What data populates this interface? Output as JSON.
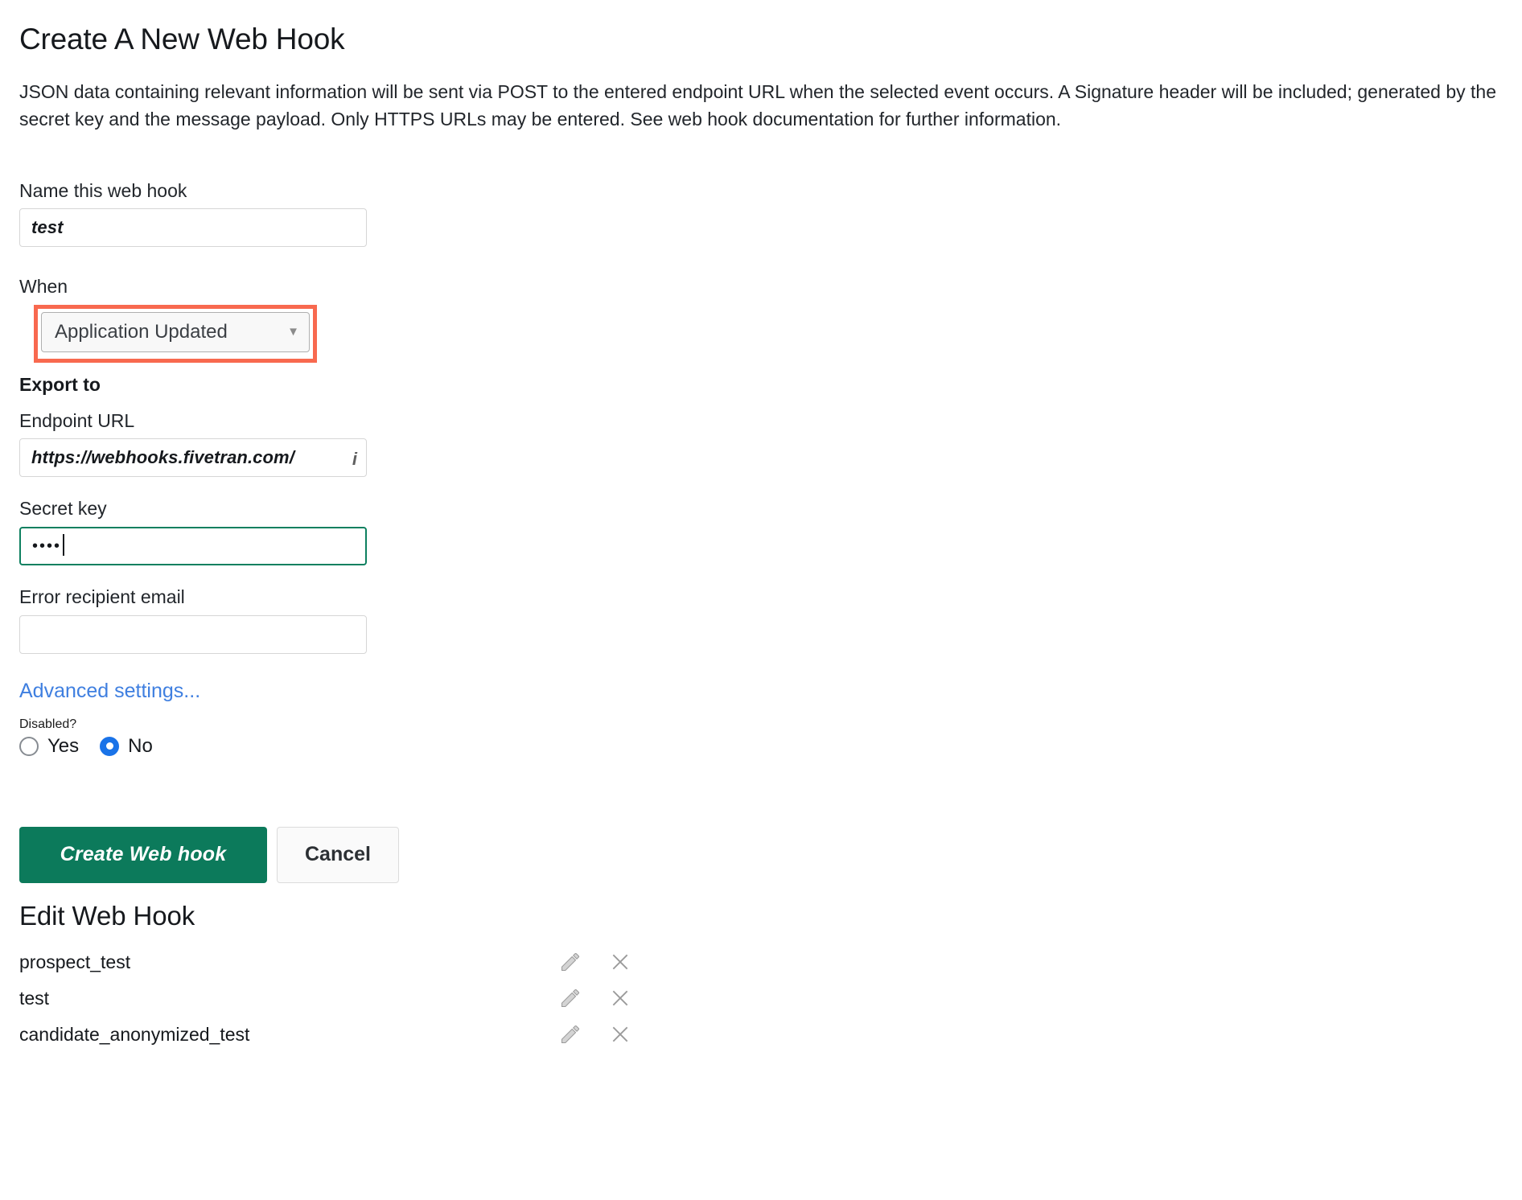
{
  "page": {
    "title": "Create A New Web Hook",
    "description": "JSON data containing relevant information will be sent via POST to the entered endpoint URL when the selected event occurs. A Signature header will be included; generated by the secret key and the message payload. Only HTTPS URLs may be entered. See web hook documentation for further information."
  },
  "form": {
    "name": {
      "label": "Name this web hook",
      "value": "test",
      "placeholder": ""
    },
    "when": {
      "label": "When",
      "selected": "Application Updated",
      "arrow_icon": "▼",
      "highlight_color": "#f8694f"
    },
    "export_to": {
      "label": "Export to"
    },
    "endpoint": {
      "label": "Endpoint URL",
      "value": "https://webhooks.fivetran.com/",
      "tail": "i",
      "placeholder": ""
    },
    "secret": {
      "label": "Secret key",
      "value": "••••",
      "placeholder": "",
      "focus_color": "#0e8060"
    },
    "error_email": {
      "label": "Error recipient email",
      "value": "",
      "placeholder": ""
    },
    "advanced_link": "Advanced settings...",
    "disabled": {
      "label": "Disabled?",
      "options": [
        {
          "label": "Yes",
          "selected": false
        },
        {
          "label": "No",
          "selected": true
        }
      ],
      "accent_color": "#1a73e8"
    }
  },
  "actions": {
    "submit_label": "Create Web hook",
    "submit_color": "#0c7a5b",
    "cancel_label": "Cancel"
  },
  "edit_section": {
    "title": "Edit Web Hook",
    "rows": [
      {
        "name": "prospect_test"
      },
      {
        "name": "test"
      },
      {
        "name": "candidate_anonymized_test"
      }
    ],
    "edit_icon": "pencil-icon",
    "delete_icon": "close-x-icon"
  }
}
